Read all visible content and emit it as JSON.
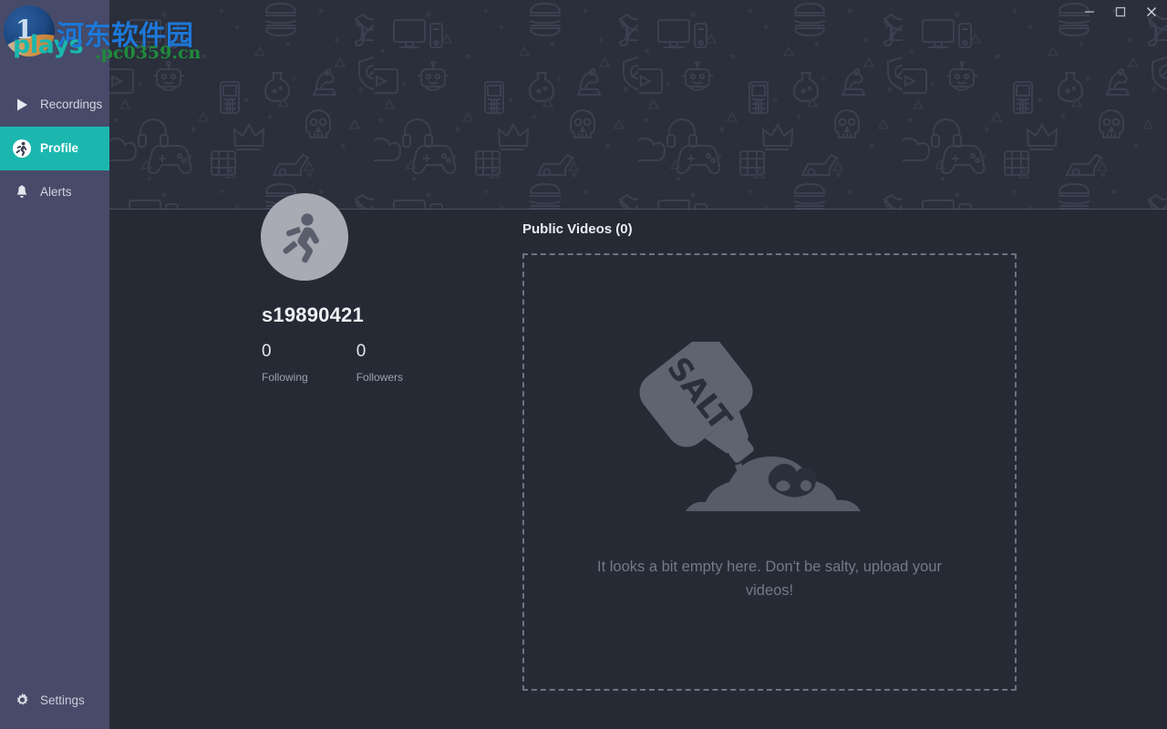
{
  "window": {
    "minimize_label": "Minimize",
    "maximize_label": "Maximize",
    "close_label": "Close"
  },
  "brand": {
    "logo_text": "plays",
    "logo_mark_glyph": "1"
  },
  "watermark": {
    "chinese": "河东软件园",
    "url": ".pc0359.cn",
    "chinese_color": "#1e78d7",
    "url_color": "#1f8a3c"
  },
  "sidebar": {
    "background": "#474b69",
    "active_color": "#1bb7ae",
    "items": [
      {
        "label": "Recordings",
        "icon": "play-icon",
        "active": false
      },
      {
        "label": "Profile",
        "icon": "runner-icon",
        "active": true
      },
      {
        "label": "Alerts",
        "icon": "bell-icon",
        "active": false
      }
    ],
    "settings": {
      "label": "Settings",
      "icon": "gear-icon"
    }
  },
  "profile": {
    "avatar_icon": "runner-avatar-icon",
    "username": "s19890421",
    "stats": [
      {
        "value": "0",
        "label": "Following"
      },
      {
        "value": "0",
        "label": "Followers"
      }
    ]
  },
  "videos": {
    "title": "Public Videos (0)",
    "count": 0,
    "empty_illustration": "salt-shaker-icon",
    "salt_label": "SALT",
    "empty_message": "It looks a bit empty here. Don't be salty, upload your videos!"
  },
  "theme": {
    "app_background": "#262a35",
    "banner_background": "#2b2f3b",
    "divider": "#4a4f60",
    "dashed_border": "#6d7384",
    "muted_text": "#9aa0b0"
  }
}
